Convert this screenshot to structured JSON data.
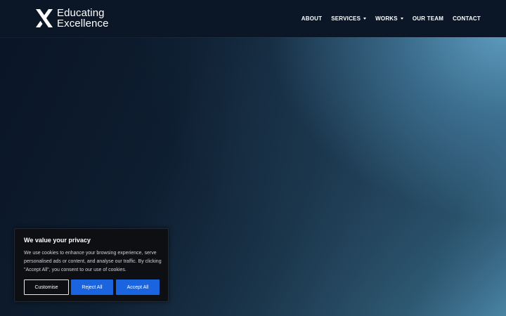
{
  "brand": {
    "line1": "Educating",
    "line2": "Excellence",
    "logo_icon": "x-mark-icon"
  },
  "nav": {
    "items": [
      {
        "label": "ABOUT",
        "has_dropdown": false
      },
      {
        "label": "SERVICES",
        "has_dropdown": true
      },
      {
        "label": "WORKS",
        "has_dropdown": true
      },
      {
        "label": "OUR TEAM",
        "has_dropdown": false
      },
      {
        "label": "CONTACT",
        "has_dropdown": false
      }
    ]
  },
  "cookie_banner": {
    "title": "We value your privacy",
    "body": "We use cookies to enhance your browsing experience, serve personalised ads or content, and analyse our traffic. By clicking \"Accept All\", you consent to our use of cookies.",
    "customise_label": "Customise",
    "reject_label": "Reject All",
    "accept_label": "Accept All"
  },
  "colors": {
    "header_bg": "#0b1727",
    "accent_blue": "#1a64e0",
    "hero_light": "#5fa0c4"
  }
}
